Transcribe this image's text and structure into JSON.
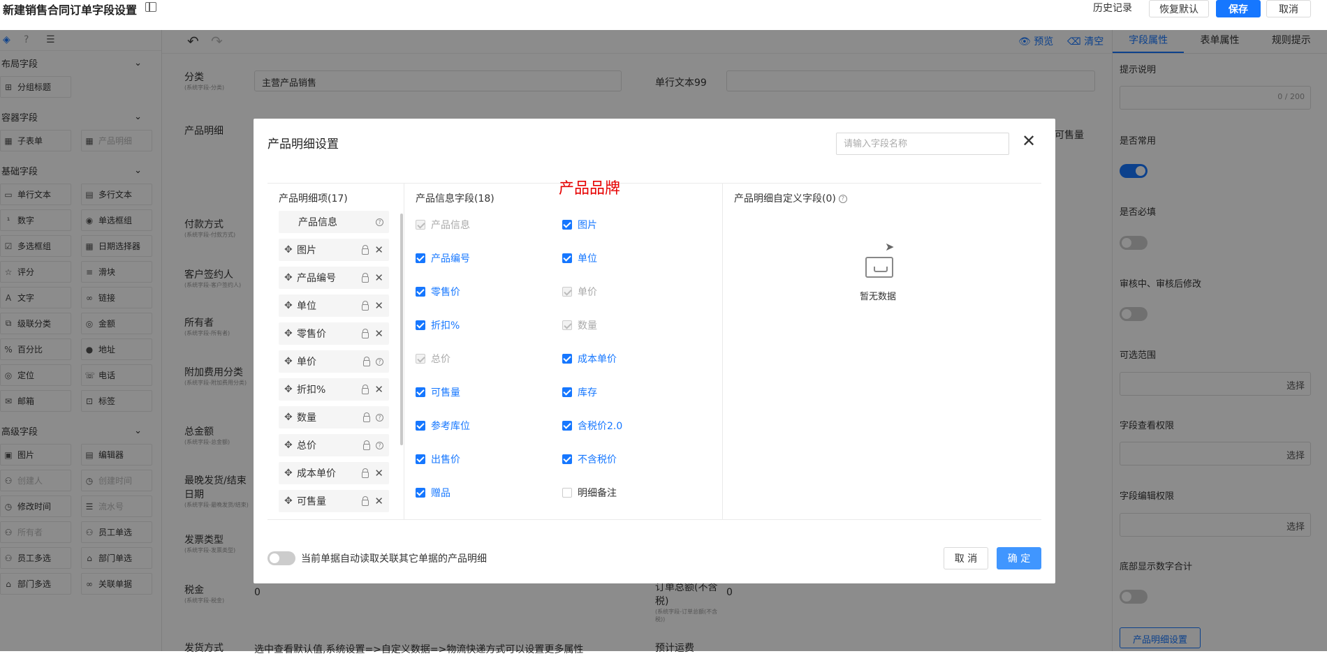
{
  "header": {
    "title": "新建销售合同订单字段设置",
    "history": "历史记录",
    "restore": "恢复默认",
    "save": "保存",
    "cancel": "取消"
  },
  "left_panel": {
    "groups": [
      {
        "label": "布局字段",
        "items": [
          {
            "label": "分组标题",
            "icon": "layout-icon",
            "disabled": false
          }
        ]
      },
      {
        "label": "容器字段",
        "items": [
          {
            "label": "子表单",
            "icon": "table-icon",
            "disabled": false
          },
          {
            "label": "产品明细",
            "icon": "table-icon",
            "disabled": true
          }
        ]
      },
      {
        "label": "基础字段",
        "items": [
          {
            "label": "单行文本",
            "icon": "input-icon",
            "disabled": false
          },
          {
            "label": "多行文本",
            "icon": "textarea-icon",
            "disabled": false
          },
          {
            "label": "数字",
            "icon": "number-icon",
            "disabled": false
          },
          {
            "label": "单选框组",
            "icon": "radio-icon",
            "disabled": false
          },
          {
            "label": "多选框组",
            "icon": "checkbox-icon",
            "disabled": false
          },
          {
            "label": "日期选择器",
            "icon": "calendar-icon",
            "disabled": false
          },
          {
            "label": "评分",
            "icon": "star-icon",
            "disabled": false
          },
          {
            "label": "滑块",
            "icon": "slider-icon",
            "disabled": false
          },
          {
            "label": "文字",
            "icon": "text-icon",
            "disabled": false
          },
          {
            "label": "链接",
            "icon": "link-icon",
            "disabled": false
          },
          {
            "label": "级联分类",
            "icon": "cascade-icon",
            "disabled": false
          },
          {
            "label": "金额",
            "icon": "money-icon",
            "disabled": false
          },
          {
            "label": "百分比",
            "icon": "percent-icon",
            "disabled": false
          },
          {
            "label": "地址",
            "icon": "location-pin-icon",
            "disabled": false
          },
          {
            "label": "定位",
            "icon": "position-icon",
            "disabled": false
          },
          {
            "label": "电话",
            "icon": "phone-icon",
            "disabled": false
          },
          {
            "label": "邮箱",
            "icon": "mail-icon",
            "disabled": false
          },
          {
            "label": "标签",
            "icon": "tag-icon",
            "disabled": false
          }
        ]
      },
      {
        "label": "高级字段",
        "items": [
          {
            "label": "图片",
            "icon": "image-icon",
            "disabled": false
          },
          {
            "label": "编辑器",
            "icon": "editor-icon",
            "disabled": false
          },
          {
            "label": "创建人",
            "icon": "user-icon",
            "disabled": true
          },
          {
            "label": "创建时间",
            "icon": "clock-icon",
            "disabled": true
          },
          {
            "label": "修改时间",
            "icon": "clock-icon",
            "disabled": false
          },
          {
            "label": "流水号",
            "icon": "list-icon",
            "disabled": true
          },
          {
            "label": "所有者",
            "icon": "user-icon",
            "disabled": true
          },
          {
            "label": "员工单选",
            "icon": "user-icon",
            "disabled": false
          },
          {
            "label": "员工多选",
            "icon": "users-icon",
            "disabled": false
          },
          {
            "label": "部门单选",
            "icon": "dept-icon",
            "disabled": false
          },
          {
            "label": "部门多选",
            "icon": "dept-icon",
            "disabled": false
          },
          {
            "label": "关联单据",
            "icon": "link-icon",
            "disabled": false
          }
        ]
      }
    ]
  },
  "canvas": {
    "preview": "预览",
    "clear": "清空",
    "fields": [
      {
        "label": "分类",
        "sub": "(系统字段-分类)",
        "value": "主营产品销售"
      },
      {
        "label": "单行文本99"
      },
      {
        "label": "产品明细"
      },
      {
        "label": "付款方式",
        "sub": "(系统字段-付款方式)"
      },
      {
        "label": "客户签约人",
        "sub": "(系统字段-客户签约人)"
      },
      {
        "label": "所有者",
        "sub": "(系统字段-所有者)"
      },
      {
        "label": "附加费用分类",
        "sub": "(系统字段-附加费用分类)"
      },
      {
        "label": "总金额",
        "sub": "(系统字段-总金额)"
      },
      {
        "label": "最晚发货/结束日期",
        "sub": "(系统字段-最晚发货/结束)"
      },
      {
        "label": "发票类型",
        "sub": "(系统字段-发票类型)"
      },
      {
        "label": "税金",
        "sub": "(系统字段-税金)",
        "value": "0"
      },
      {
        "label": "订单总额(不含税)",
        "sub": "(系统字段-订单总额(不含税))",
        "value": "0"
      },
      {
        "label": "发货方式",
        "value": "选中查看默认值,系统设置=>自定义数据=>物流快递方式可以设置更多属性"
      },
      {
        "label": "预计运费"
      }
    ],
    "behind_modal_text": "可售量"
  },
  "right_panel": {
    "tabs": [
      "字段属性",
      "表单属性",
      "规则提示"
    ],
    "active_tab": 0,
    "hint_label": "提示说明",
    "hint_count": "0 / 200",
    "common_label": "是否常用",
    "common_on": true,
    "required_label": "是否必填",
    "required_on": false,
    "modify_label": "审核中、审核后修改",
    "modify_on": false,
    "range_label": "可选范围",
    "range_select": "选择",
    "view_perm_label": "字段查看权限",
    "view_perm_select": "选择",
    "edit_perm_label": "字段编辑权限",
    "edit_perm_select": "选择",
    "sum_label": "底部显示数字合计",
    "sum_on": false,
    "product_detail_btn": "产品明细设置"
  },
  "modal": {
    "title": "产品明细设置",
    "search_placeholder": "请输入字段名称",
    "annotation": "产品品牌",
    "col1_title": "产品明细项",
    "col1_count": "(17)",
    "col2_title": "产品信息字段",
    "col2_count": "(18)",
    "col3_title": "产品明细自定义字段",
    "col3_count": "(0)",
    "items": [
      {
        "label": "产品信息",
        "removable": false,
        "help": true,
        "first": true
      },
      {
        "label": "图片",
        "removable": true
      },
      {
        "label": "产品编号",
        "removable": true
      },
      {
        "label": "单位",
        "removable": true
      },
      {
        "label": "零售价",
        "removable": true
      },
      {
        "label": "单价",
        "removable": false,
        "help": true
      },
      {
        "label": "折扣%",
        "removable": true
      },
      {
        "label": "数量",
        "removable": false,
        "help": true
      },
      {
        "label": "总价",
        "removable": false,
        "help": true
      },
      {
        "label": "成本单价",
        "removable": true
      },
      {
        "label": "可售量",
        "removable": true
      }
    ],
    "checkboxes": [
      {
        "label": "产品信息",
        "state": "disabled"
      },
      {
        "label": "图片",
        "state": "checked"
      },
      {
        "label": "产品编号",
        "state": "checked"
      },
      {
        "label": "单位",
        "state": "checked"
      },
      {
        "label": "零售价",
        "state": "checked"
      },
      {
        "label": "单价",
        "state": "disabled"
      },
      {
        "label": "折扣%",
        "state": "checked"
      },
      {
        "label": "数量",
        "state": "disabled"
      },
      {
        "label": "总价",
        "state": "disabled"
      },
      {
        "label": "成本单价",
        "state": "checked"
      },
      {
        "label": "可售量",
        "state": "checked"
      },
      {
        "label": "库存",
        "state": "checked"
      },
      {
        "label": "参考库位",
        "state": "checked"
      },
      {
        "label": "含税价2.0",
        "state": "checked"
      },
      {
        "label": "出售价",
        "state": "checked"
      },
      {
        "label": "不含税价",
        "state": "checked"
      },
      {
        "label": "赠品",
        "state": "checked"
      },
      {
        "label": "明细备注",
        "state": "unchecked"
      }
    ],
    "empty_text": "暂无数据",
    "auto_read_label": "当前单据自动读取关联其它单据的产品明细",
    "auto_read_on": false,
    "cancel": "取 消",
    "ok": "确 定"
  }
}
